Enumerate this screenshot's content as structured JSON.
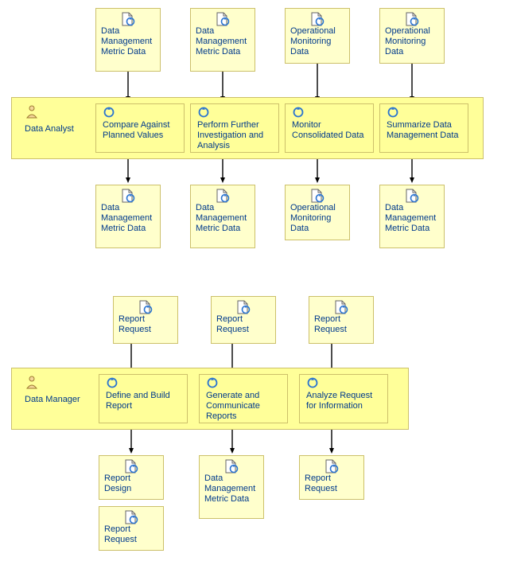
{
  "inputs_top1": {
    "a": "Data Management Metric Data",
    "b": "Data Management Metric Data",
    "c": "Operational Monitoring Data",
    "d": "Operational Monitoring Data"
  },
  "lane1": {
    "role": "Data Analyst",
    "task_a": "Compare Against Planned Values",
    "task_b": "Perform Further Investigation and Analysis",
    "task_c": "Monitor Consolidated Data",
    "task_d": "Summarize Data Management Data"
  },
  "outputs_top1": {
    "a": "Data Management Metric Data",
    "b": "Data Management Metric Data",
    "c": "Operational Monitoring Data",
    "d": "Data Management Metric Data"
  },
  "inputs_top2": {
    "a": "Report Request",
    "b": "Report Request",
    "c": "Report Request"
  },
  "lane2": {
    "role": "Data Manager",
    "task_a": "Define and Build Report",
    "task_b": "Generate and Communicate Reports",
    "task_c": "Analyze Request for Information"
  },
  "outputs_top2": {
    "a1": "Report Design",
    "a2": "Report Request",
    "b": "Data Management Metric Data",
    "c": "Report Request"
  },
  "icons": {
    "artifact": "document-cycle-icon",
    "role": "role-icon",
    "task": "task-cycle-icon"
  }
}
